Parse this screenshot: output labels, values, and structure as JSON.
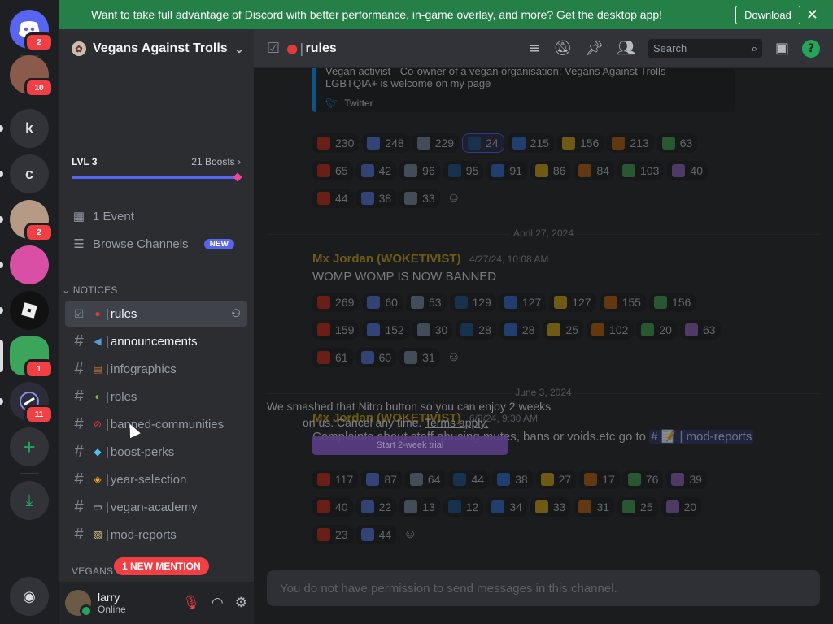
{
  "banner": {
    "text": "Want to take full advantage of Discord with better performance, in-game overlay, and more? Get the desktop app!",
    "download": "Download"
  },
  "rail": {
    "servers": [
      {
        "label": "",
        "badge": "2",
        "icon": "discord-icon"
      },
      {
        "label": "",
        "badge": "10"
      },
      {
        "label": "k",
        "badge": ""
      },
      {
        "label": "c",
        "badge": ""
      },
      {
        "label": "",
        "badge": "2"
      },
      {
        "label": "",
        "badge": ""
      },
      {
        "label": "",
        "badge": ""
      },
      {
        "label": "",
        "badge": "1"
      },
      {
        "label": "",
        "badge": "11"
      }
    ]
  },
  "server": {
    "name": "Vegans Against Trolls"
  },
  "boost": {
    "level": "LVL 3",
    "count": "21 Boosts",
    "progress": 1.0
  },
  "sidebar": {
    "events": "1 Event",
    "browse": "Browse Channels",
    "new_tag": "NEW"
  },
  "categories": {
    "notices": "NOTICES",
    "vegans": "VEGANS"
  },
  "channels": [
    {
      "name": "rules",
      "emoji": "apple"
    },
    {
      "name": "announcements",
      "emoji": "megaphone"
    },
    {
      "name": "infographics",
      "emoji": "books"
    },
    {
      "name": "roles",
      "emoji": "avocado"
    },
    {
      "name": "banned-communities",
      "emoji": "no-entry"
    },
    {
      "name": "boost-perks",
      "emoji": "gem"
    },
    {
      "name": "year-selection",
      "emoji": "diamond-sign"
    },
    {
      "name": "vegan-academy",
      "emoji": "book"
    },
    {
      "name": "mod-reports",
      "emoji": "memo"
    }
  ],
  "mention_pill": "1 NEW MENTION",
  "user": {
    "name": "larry",
    "status": "Online"
  },
  "header": {
    "channel": "rules",
    "search": "Search"
  },
  "embed": {
    "line1": "Vegan activist - Co-owner of a vegan organisation: Vegans Against Trolls",
    "line2": "LGBTQIA+ is welcome on my page",
    "footer": "Twitter"
  },
  "reactions1": [
    [
      "230",
      "248",
      "229",
      "24",
      "215",
      "156",
      "213",
      "63"
    ],
    [
      "65",
      "42",
      "96",
      "95",
      "91",
      "86",
      "84",
      "103",
      "40"
    ],
    [
      "44",
      "38",
      "33"
    ]
  ],
  "date1": "April 27, 2024",
  "msg1": {
    "author": "Mx Jordan (WOKETIVIST)",
    "time": "4/27/24, 10:08 AM",
    "body": "WOMP WOMP IS NOW BANNED"
  },
  "reactions2": [
    [
      "269",
      "60",
      "53",
      "129",
      "127",
      "127",
      "155",
      "156"
    ],
    [
      "159",
      "152",
      "30",
      "28",
      "28",
      "25",
      "102",
      "20",
      "63"
    ],
    [
      "61",
      "60",
      "31"
    ]
  ],
  "date2": "June 3, 2024",
  "msg2": {
    "author": "Mx Jordan (WOKETIVIST)",
    "time": "6/3/24, 9:30 AM",
    "body": "Complaints about staff abusing mutes, bans or voids.etc go to",
    "mention": "# 📝 | mod-reports"
  },
  "reactions3": [
    [
      "117",
      "87",
      "64",
      "44",
      "38",
      "27",
      "17",
      "76",
      "39"
    ],
    [
      "40",
      "22",
      "13",
      "12",
      "34",
      "33",
      "31",
      "25",
      "20"
    ],
    [
      "23",
      "44"
    ]
  ],
  "nitro": {
    "line1": "We smashed that Nitro button so you can enjoy 2 weeks",
    "line2": "on us. Cancel any time.",
    "terms": "Terms apply.",
    "button": "Start 2-week trial"
  },
  "composer": {
    "placeholder": "You do not have permission to send messages in this channel."
  },
  "colors": {
    "accent": "#5865f2",
    "banner": "#248046",
    "badge": "#f23f43",
    "online": "#23a55a"
  }
}
